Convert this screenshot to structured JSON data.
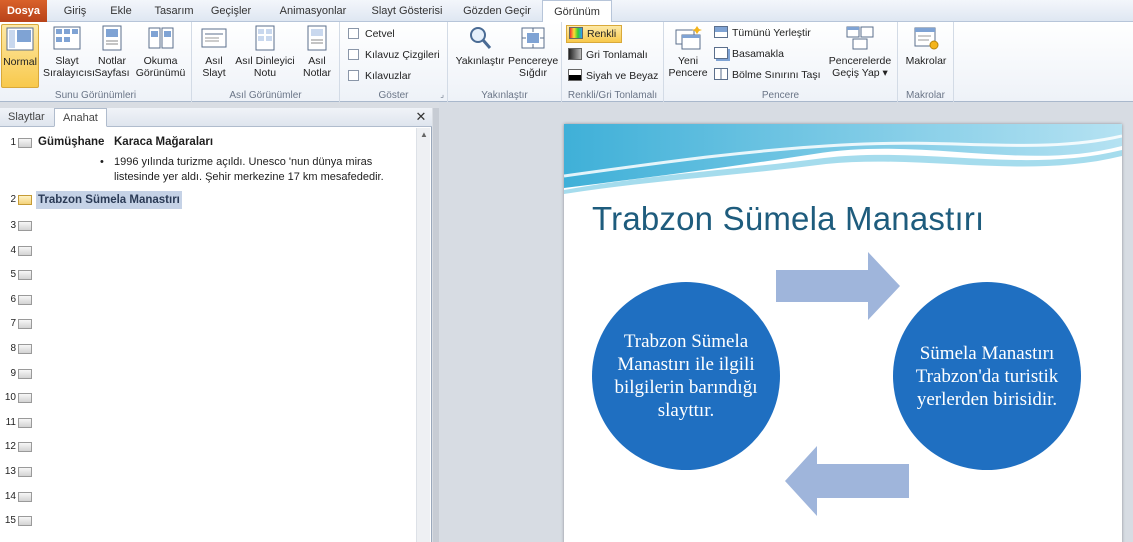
{
  "ribbon_tabs": [
    "Dosya",
    "Giriş",
    "Ekle",
    "Tasarım",
    "Geçişler",
    "Animasyonlar",
    "Slayt Gösterisi",
    "Gözden Geçir",
    "Görünüm"
  ],
  "ribbon": {
    "presentation_views": {
      "label": "Sunu Görünümleri",
      "buttons": [
        {
          "line1": "Normal",
          "line2": ""
        },
        {
          "line1": "Slayt",
          "line2": "Sıralayıcısı"
        },
        {
          "line1": "Notlar",
          "line2": "Sayfası"
        },
        {
          "line1": "Okuma",
          "line2": "Görünümü"
        }
      ]
    },
    "master_views": {
      "label": "Asıl Görünümler",
      "buttons": [
        {
          "line1": "Asıl",
          "line2": "Slayt"
        },
        {
          "line1": "Asıl Dinleyici",
          "line2": "Notu"
        },
        {
          "line1": "Asıl",
          "line2": "Notlar"
        }
      ]
    },
    "show": {
      "label": "Göster",
      "items": [
        "Cetvel",
        "Kılavuz Çizgileri",
        "Kılavuzlar"
      ]
    },
    "zoom": {
      "label": "Yakınlaştır",
      "buttons": [
        {
          "line1": "Yakınlaştır",
          "line2": ""
        },
        {
          "line1": "Pencereye",
          "line2": "Sığdır"
        }
      ]
    },
    "color": {
      "label": "Renkli/Gri Tonlamalı",
      "items": [
        "Renkli",
        "Gri Tonlamalı",
        "Siyah ve Beyaz"
      ]
    },
    "window": {
      "label": "Pencere",
      "new_window": {
        "line1": "Yeni",
        "line2": "Pencere"
      },
      "items": [
        "Tümünü Yerleştir",
        "Basamakla",
        "Bölme Sınırını Taşı"
      ],
      "switch": {
        "line1": "Pencerelerde",
        "line2": "Geçiş Yap ▾"
      }
    },
    "macros": {
      "label": "Makrolar",
      "button": "Makrolar"
    }
  },
  "pane": {
    "tabs": [
      "Slaytlar",
      "Anahat"
    ],
    "close": "✕",
    "outline": {
      "slide1": {
        "num": "1",
        "title_a": "Gümüşhane",
        "title_b": "Karaca Mağaraları",
        "bullet": "•",
        "body1": "1996 yılında turizme açıldı. Unesco 'nun dünya miras",
        "body2": "listesinde yer aldı. Şehir merkezine 17 km mesafededir."
      },
      "slide2": {
        "num": "2",
        "title": "Trabzon Sümela Manastırı"
      },
      "numbers": [
        "3",
        "4",
        "5",
        "6",
        "7",
        "8",
        "9",
        "10",
        "11",
        "12",
        "13",
        "14",
        "15"
      ]
    }
  },
  "slide": {
    "title": "Trabzon Sümela Manastırı",
    "left_circle": "Trabzon Sümela Manastırı ile ilgili bilgilerin barındığı slayttır.",
    "right_circle": "Sümela Manastırı Trabzon'da turistik yerlerden birisidir.",
    "colors": {
      "circle": "#1f6fc1",
      "arrow": "#9fb5db",
      "title": "#1e5c7d"
    }
  }
}
